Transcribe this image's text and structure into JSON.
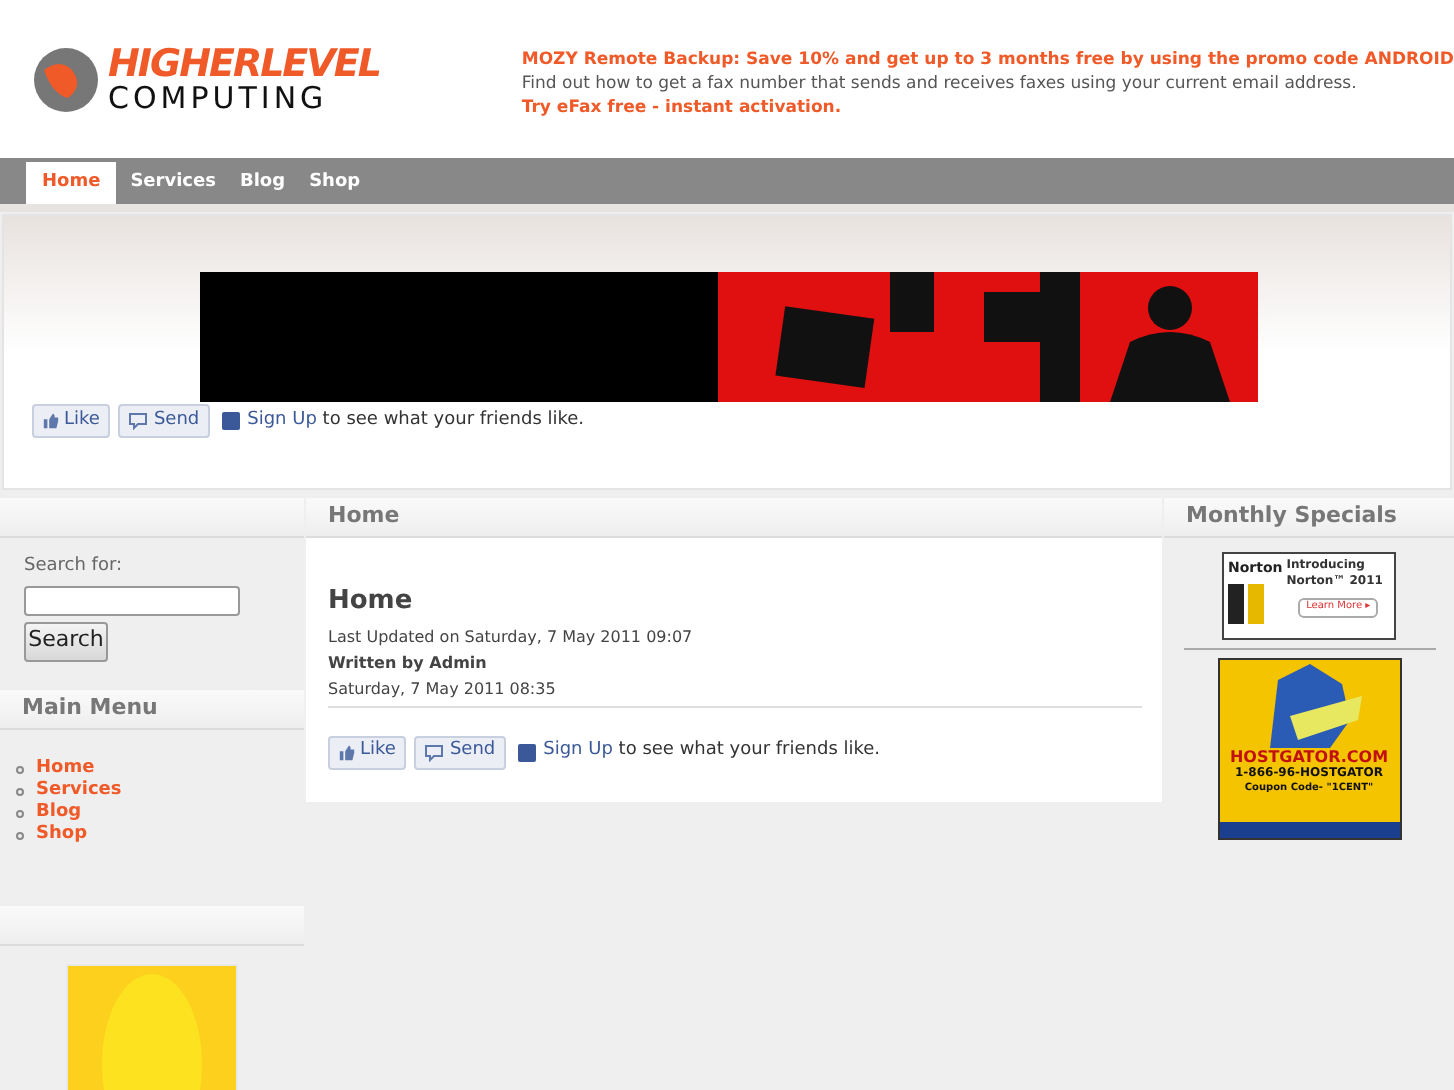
{
  "logo": {
    "top": "HIGHERLEVEL",
    "bottom": "COMPUTING"
  },
  "promo": {
    "headline": "MOZY Remote Backup: Save 10% and get up to 3 months free by using the promo code ANDROID",
    "text": "Find out how to get a fax number that sends and receives faxes using your current email address.",
    "link": "Try eFax free - instant activation."
  },
  "nav": [
    {
      "label": "Home",
      "selected": true
    },
    {
      "label": "Services",
      "selected": false
    },
    {
      "label": "Blog",
      "selected": false
    },
    {
      "label": "Shop",
      "selected": false
    }
  ],
  "banner_social": {
    "like": "Like",
    "send": "Send",
    "signup": "Sign Up",
    "text": "to see what your friends like."
  },
  "search": {
    "label": "Search for:",
    "button": "Search"
  },
  "main_menu": {
    "title": "Main Menu",
    "items": [
      "Home",
      "Services",
      "Blog",
      "Shop"
    ]
  },
  "content": {
    "header": "Home",
    "title": "Home",
    "updated": "Last Updated on Saturday, 7 May 2011 09:07",
    "author": "Written by Admin",
    "date": "Saturday, 7 May 2011 08:35",
    "social": {
      "like": "Like",
      "send": "Send",
      "signup": "Sign Up",
      "text": "to see what your friends like."
    }
  },
  "specials": {
    "title": "Monthly Specials",
    "norton": {
      "brand": "Norton",
      "headline": "Introducing Norton™ 2011",
      "button": "Learn More ▸"
    },
    "hostgator": {
      "domain": "HOSTGATOR.COM",
      "phone": "1-866-96-HOSTGATOR",
      "coupon": "Coupon Code- \"1CENT\""
    }
  }
}
